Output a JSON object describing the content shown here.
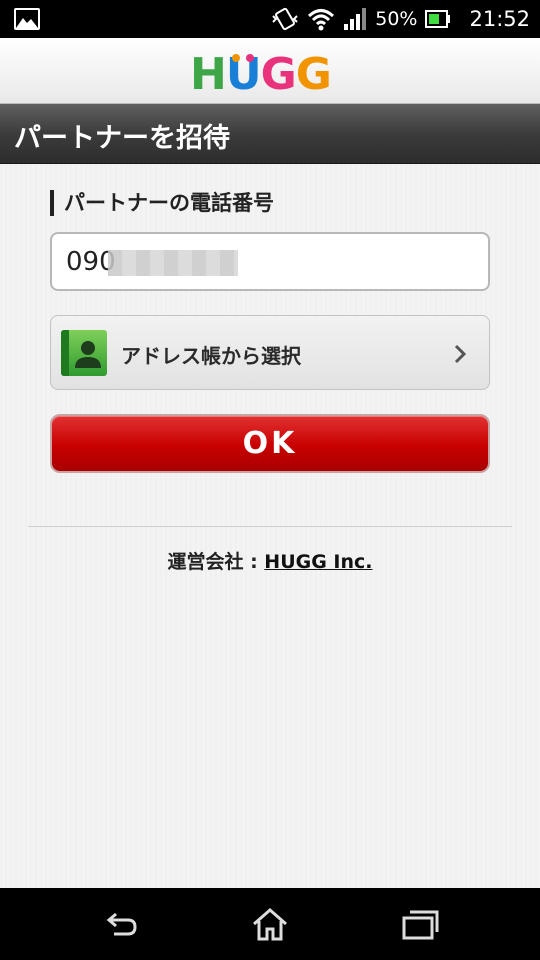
{
  "status_bar": {
    "battery_percent": "50%",
    "time": "21:52"
  },
  "header": {
    "logo": "HUGG",
    "title": "パートナーを招待"
  },
  "form": {
    "phone_label": "パートナーの電話番号",
    "phone_value": "090",
    "address_book_label": "アドレス帳から選択",
    "ok_label": "OK"
  },
  "footer": {
    "operator_label": "運営会社 : ",
    "company_link": "HUGG Inc."
  },
  "colors": {
    "ok_button": "#c80000",
    "title_bar": "#3c3c3c",
    "logo_h": "#3fa648",
    "logo_u": "#1a7fd6",
    "logo_g1": "#e8327c",
    "logo_g2": "#f29400"
  },
  "icons": {
    "status_left": "gallery-icon",
    "status_right": [
      "vibrate-icon",
      "wifi-icon",
      "signal-icon",
      "battery-icon"
    ],
    "address": "contact-icon",
    "address_arrow": "chevron-right-icon",
    "nav": [
      "back-icon",
      "home-icon",
      "recent-apps-icon"
    ]
  }
}
